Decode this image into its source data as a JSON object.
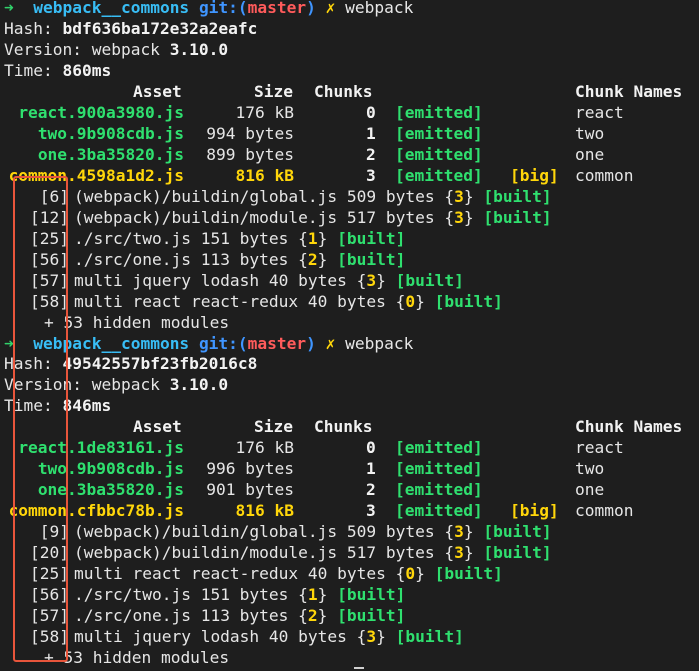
{
  "colors": {
    "background": "#1e1e1e",
    "prompt_arrow": "#31d26b",
    "directory": "#38bdf5",
    "git_label": "#3f95ff",
    "branch": "#ff5b5b",
    "emitted": "#31d26b",
    "chunk_id": "#ffd60a",
    "annotation_box": "#e8553b"
  },
  "prompt": {
    "arrow": "➜",
    "dir": "webpack__commons",
    "git_open": "git:(",
    "branch": "master",
    "git_close": ")",
    "dirty": "✗",
    "command": "webpack"
  },
  "header": {
    "asset": "Asset",
    "size": "Size",
    "chunks": "Chunks",
    "chunk_names": "Chunk Names"
  },
  "runs": [
    {
      "hash_label": "Hash: ",
      "hash": "bdf636ba172e32a2eafc",
      "version_label": "Version: webpack ",
      "version": "3.10.0",
      "time_label": "Time: ",
      "time": "860ms",
      "assets": [
        {
          "name": "react.900a3980.js",
          "size": "176 kB",
          "chunk": "0",
          "status": "[emitted]",
          "big": "",
          "chunk_name": "react"
        },
        {
          "name": "two.9b908cdb.js",
          "size": "994 bytes",
          "chunk": "1",
          "status": "[emitted]",
          "big": "",
          "chunk_name": "two"
        },
        {
          "name": "one.3ba35820.js",
          "size": "899 bytes",
          "chunk": "2",
          "status": "[emitted]",
          "big": "",
          "chunk_name": "one"
        },
        {
          "name": "common.4598a1d2.js",
          "size": "816 kB",
          "chunk": "3",
          "status": "[emitted]",
          "big": "[big]",
          "chunk_name": "common"
        }
      ],
      "modules": [
        {
          "id": "[6]",
          "path": "(webpack)/buildin/global.js",
          "size": "509 bytes",
          "chunk": "3",
          "status": "[built]"
        },
        {
          "id": "[12]",
          "path": "(webpack)/buildin/module.js",
          "size": "517 bytes",
          "chunk": "3",
          "status": "[built]"
        },
        {
          "id": "[25]",
          "path": "./src/two.js",
          "size": "151 bytes",
          "chunk": "1",
          "status": "[built]"
        },
        {
          "id": "[56]",
          "path": "./src/one.js",
          "size": "113 bytes",
          "chunk": "2",
          "status": "[built]"
        },
        {
          "id": "[57]",
          "path": "multi jquery lodash",
          "size": "40 bytes",
          "chunk": "3",
          "status": "[built]"
        },
        {
          "id": "[58]",
          "path": "multi react react-redux",
          "size": "40 bytes",
          "chunk": "0",
          "status": "[built]"
        }
      ],
      "hidden": "+ 53 hidden modules"
    },
    {
      "hash_label": "Hash: ",
      "hash": "49542557bf23fb2016c8",
      "version_label": "Version: webpack ",
      "version": "3.10.0",
      "time_label": "Time: ",
      "time": "846ms",
      "assets": [
        {
          "name": "react.1de83161.js",
          "size": "176 kB",
          "chunk": "0",
          "status": "[emitted]",
          "big": "",
          "chunk_name": "react"
        },
        {
          "name": "two.9b908cdb.js",
          "size": "996 bytes",
          "chunk": "1",
          "status": "[emitted]",
          "big": "",
          "chunk_name": "two"
        },
        {
          "name": "one.3ba35820.js",
          "size": "901 bytes",
          "chunk": "2",
          "status": "[emitted]",
          "big": "",
          "chunk_name": "one"
        },
        {
          "name": "common.cfbbc78b.js",
          "size": "816 kB",
          "chunk": "3",
          "status": "[emitted]",
          "big": "[big]",
          "chunk_name": "common"
        }
      ],
      "modules": [
        {
          "id": "[9]",
          "path": "(webpack)/buildin/global.js",
          "size": "509 bytes",
          "chunk": "3",
          "status": "[built]"
        },
        {
          "id": "[20]",
          "path": "(webpack)/buildin/module.js",
          "size": "517 bytes",
          "chunk": "3",
          "status": "[built]"
        },
        {
          "id": "[25]",
          "path": "multi react react-redux",
          "size": "40 bytes",
          "chunk": "0",
          "status": "[built]"
        },
        {
          "id": "[56]",
          "path": "./src/two.js",
          "size": "151 bytes",
          "chunk": "1",
          "status": "[built]"
        },
        {
          "id": "[57]",
          "path": "./src/one.js",
          "size": "113 bytes",
          "chunk": "2",
          "status": "[built]"
        },
        {
          "id": "[58]",
          "path": "multi jquery lodash",
          "size": "40 bytes",
          "chunk": "3",
          "status": "[built]"
        }
      ],
      "hidden": "+ 53 hidden modules"
    }
  ]
}
